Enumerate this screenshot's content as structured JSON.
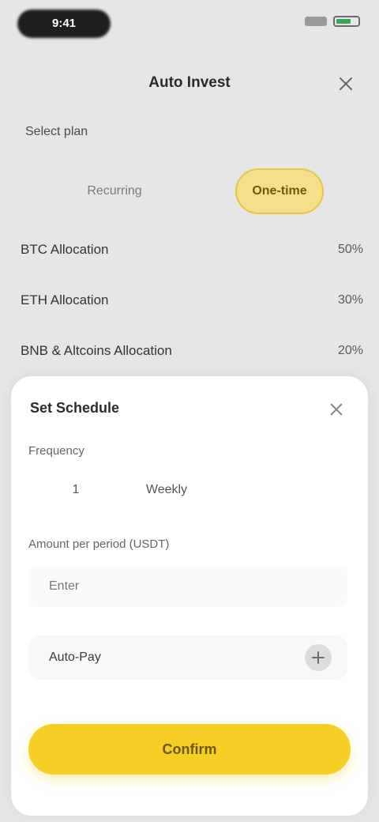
{
  "status": {
    "time": "9:41"
  },
  "header": {
    "title": "Auto Invest",
    "close_icon": "close-icon"
  },
  "plan": {
    "label": "Select plan",
    "tabs": [
      {
        "label": "Recurring"
      },
      {
        "label": "One-time"
      }
    ]
  },
  "rows": [
    {
      "label": "BTC Allocation",
      "value": "50%"
    },
    {
      "label": "ETH Allocation",
      "value": "30%"
    },
    {
      "label": "BNB & Altcoins Allocation",
      "value": "20%"
    }
  ],
  "sheet": {
    "title": "Set Schedule",
    "close_icon": "close-icon",
    "frequency_label": "Frequency",
    "frequency_options": [
      "1",
      "Weekly"
    ],
    "amount_label": "Amount per period (USDT)",
    "amount_placeholder": "Enter",
    "option_label": "Auto-Pay",
    "add_icon": "plus-icon",
    "confirm_label": "Confirm"
  },
  "colors": {
    "accent": "#f5cf25",
    "tab_active": "#f6df8a"
  }
}
